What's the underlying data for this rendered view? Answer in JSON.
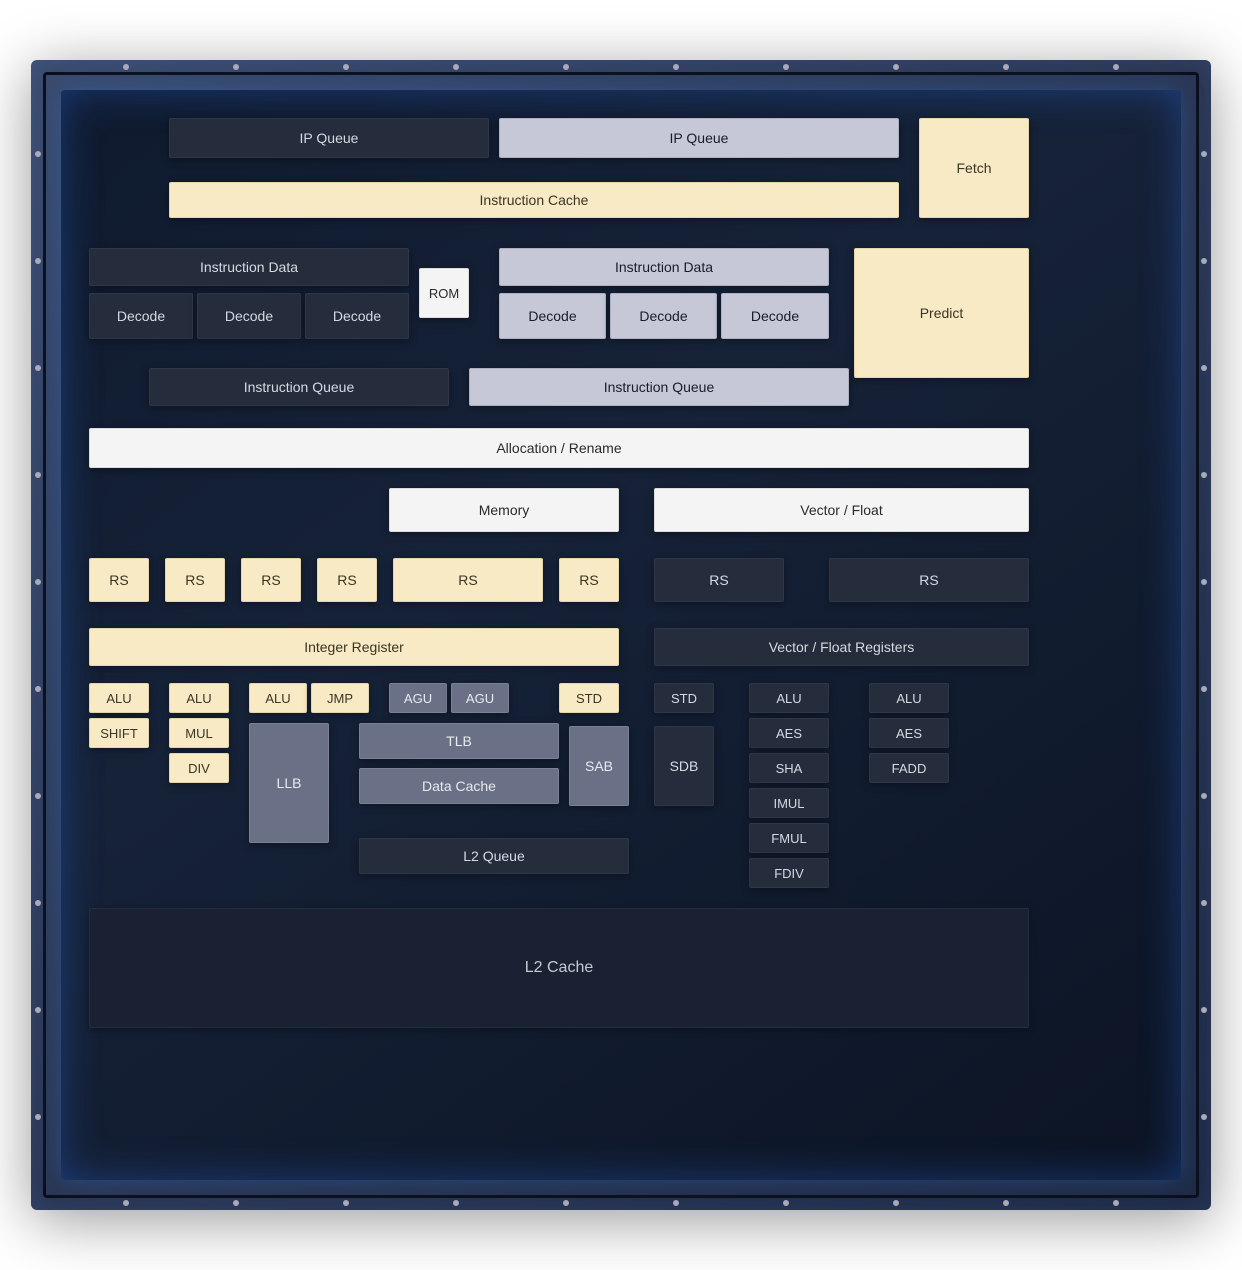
{
  "frontend": {
    "ip_queue_left": "IP Queue",
    "ip_queue_right": "IP Queue",
    "fetch": "Fetch",
    "instruction_cache": "Instruction Cache",
    "instruction_data_left": "Instruction Data",
    "instruction_data_right": "Instruction Data",
    "rom": "ROM",
    "predict": "Predict",
    "decode_l0": "Decode",
    "decode_l1": "Decode",
    "decode_l2": "Decode",
    "decode_r0": "Decode",
    "decode_r1": "Decode",
    "decode_r2": "Decode",
    "instruction_queue_left": "Instruction Queue",
    "instruction_queue_right": "Instruction Queue"
  },
  "middle": {
    "allocation_rename": "Allocation / Rename",
    "memory": "Memory",
    "vector_float": "Vector / Float"
  },
  "rs": {
    "rs0": "RS",
    "rs1": "RS",
    "rs2": "RS",
    "rs3": "RS",
    "rs4": "RS",
    "rs5": "RS",
    "rs6": "RS",
    "rs7": "RS"
  },
  "registers": {
    "integer_register": "Integer Register",
    "vector_float_registers": "Vector / Float Registers"
  },
  "exec": {
    "alu0": "ALU",
    "shift": "SHIFT",
    "alu1": "ALU",
    "mul": "MUL",
    "div": "DIV",
    "alu2": "ALU",
    "jmp": "JMP",
    "agu0": "AGU",
    "agu1": "AGU",
    "std0": "STD",
    "std1": "STD",
    "llb": "LLB",
    "tlb": "TLB",
    "data_cache": "Data Cache",
    "sab": "SAB",
    "sdb": "SDB",
    "l2_queue": "L2 Queue",
    "v_alu0": "ALU",
    "v_aes0": "AES",
    "v_sha": "SHA",
    "v_imul": "IMUL",
    "v_fmul": "FMUL",
    "v_fdiv": "FDIV",
    "v_alu1": "ALU",
    "v_aes1": "AES",
    "v_fadd": "FADD"
  },
  "cache": {
    "l2_cache": "L2 Cache"
  }
}
